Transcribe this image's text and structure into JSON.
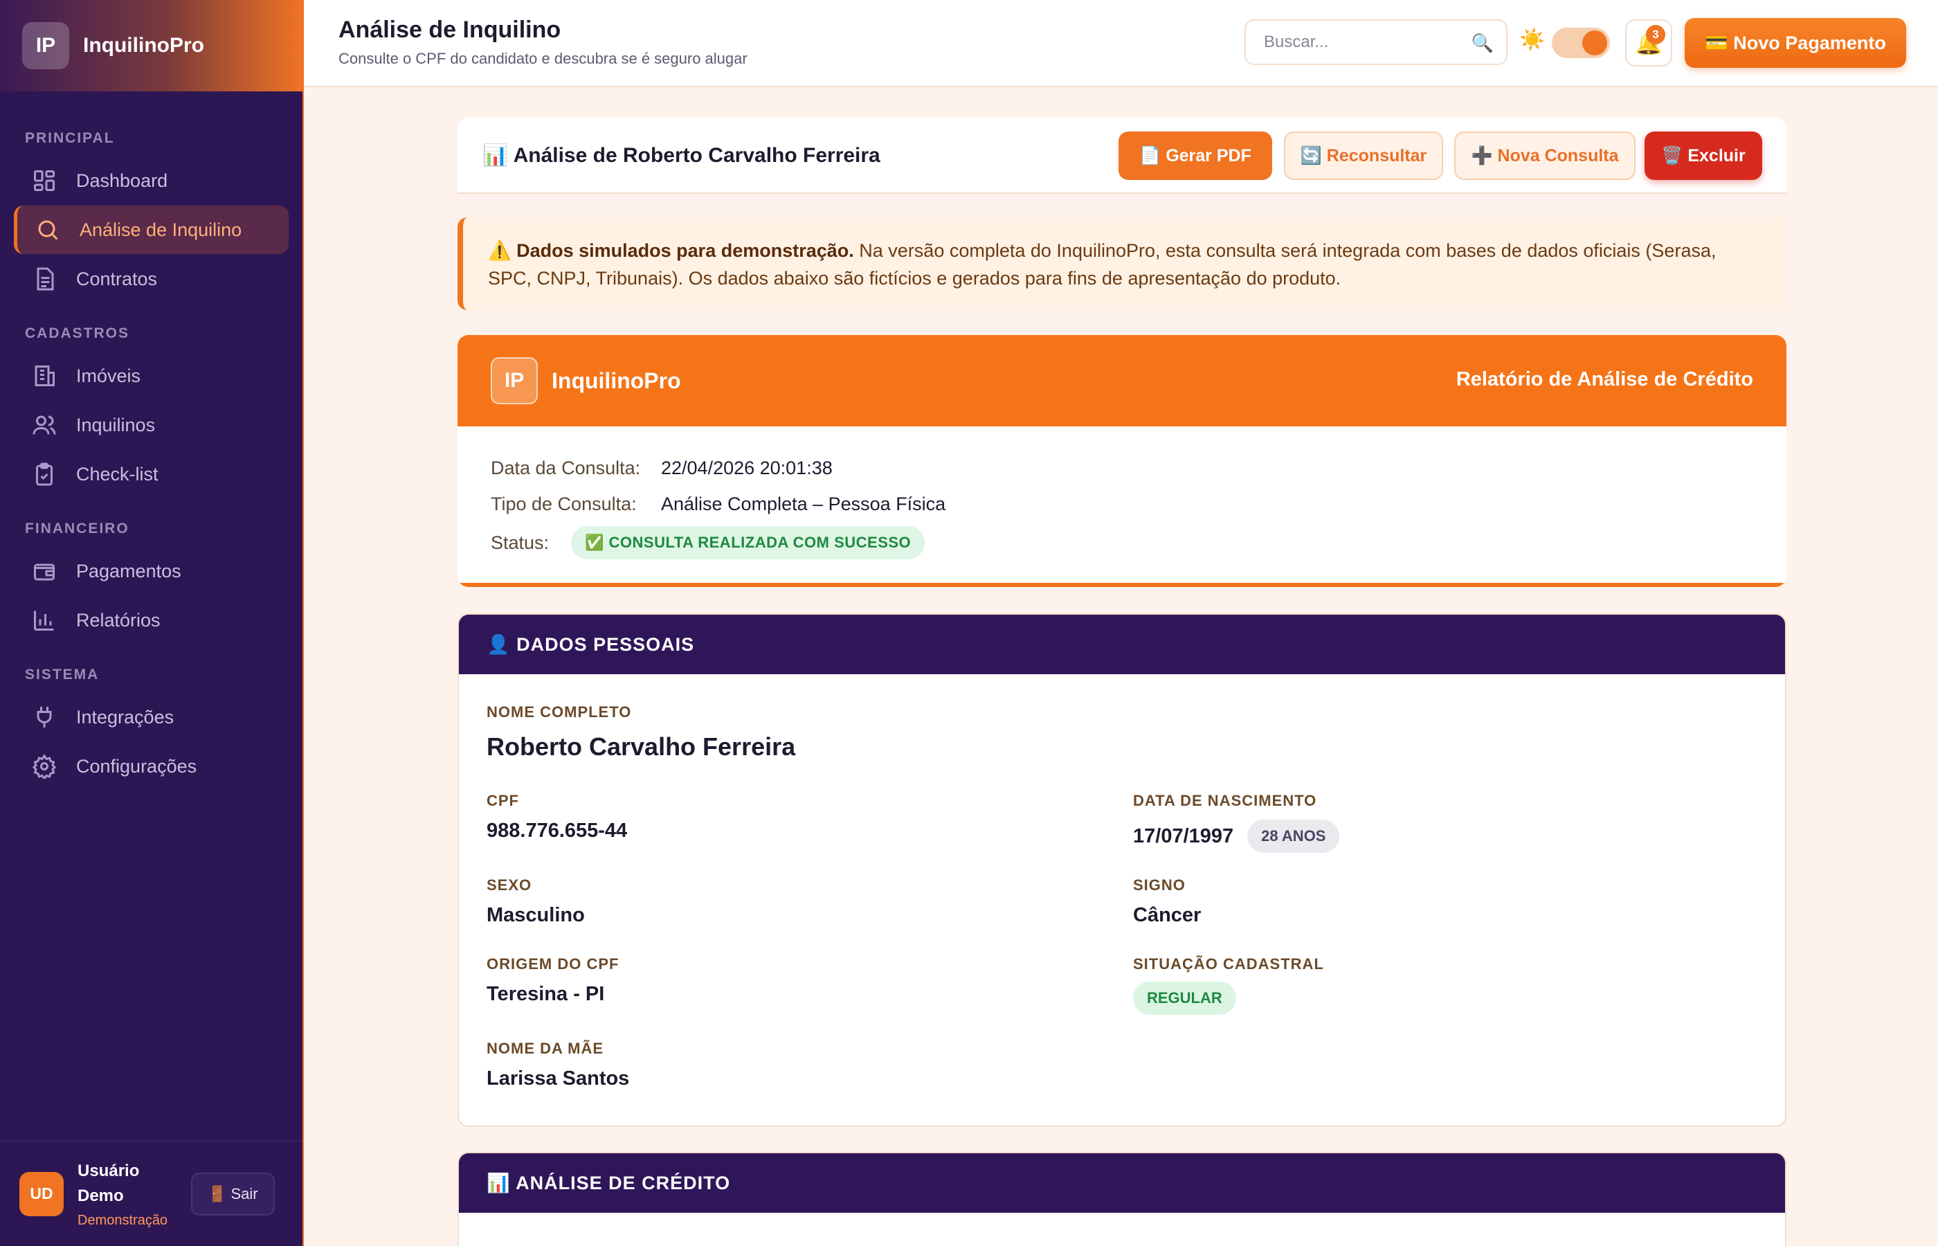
{
  "brand": {
    "initials": "IP",
    "name": "InquilinoPro"
  },
  "nav": {
    "sections": {
      "principal": "PRINCIPAL",
      "cadastros": "CADASTROS",
      "financeiro": "FINANCEIRO",
      "sistema": "SISTEMA"
    },
    "items": [
      {
        "label": "Dashboard",
        "icon": "dashboard-icon"
      },
      {
        "label": "Análise de Inquilino",
        "icon": "search-icon",
        "active": true
      },
      {
        "label": "Contratos",
        "icon": "document-icon"
      },
      {
        "label": "Imóveis",
        "icon": "building-icon"
      },
      {
        "label": "Inquilinos",
        "icon": "users-icon"
      },
      {
        "label": "Check-list",
        "icon": "clipboard-check-icon"
      },
      {
        "label": "Pagamentos",
        "icon": "wallet-icon"
      },
      {
        "label": "Relatórios",
        "icon": "bar-chart-icon"
      },
      {
        "label": "Integrações",
        "icon": "plug-icon"
      },
      {
        "label": "Configurações",
        "icon": "gear-icon"
      }
    ]
  },
  "user": {
    "initials": "UD",
    "name": "Usuário Demo",
    "role": "Demonstração",
    "logout": "🚪 Sair"
  },
  "header": {
    "title": "Análise de Inquilino",
    "subtitle": "Consulte o CPF do candidato e descubra se é seguro alugar",
    "search_placeholder": "Buscar...",
    "notifications": "3",
    "new_payment": "💳 Novo Pagamento"
  },
  "analysis": {
    "title": "📊 Análise de Roberto Carvalho Ferreira",
    "buttons": {
      "pdf": "📄 Gerar PDF",
      "reconsult": "🔄 Reconsultar",
      "new": "➕ Nova Consulta",
      "delete": "🗑️ Excluir"
    }
  },
  "warning": {
    "bold": "⚠️ Dados simulados para demonstração.",
    "text": " Na versão completa do InquilinoPro, esta consulta será integrada com bases de dados oficiais (Serasa, SPC, CNPJ, Tribunais). Os dados abaixo são fictícios e gerados para fins de apresentação do produto."
  },
  "report": {
    "logo": "IP",
    "brand": "InquilinoPro",
    "subtitle": "Relatório de Análise de Crédito",
    "date_label": "Data da Consulta:",
    "date_value": "22/04/2026 20:01:38",
    "type_label": "Tipo de Consulta:",
    "type_value": "Análise Completa – Pessoa Física",
    "status_label": "Status:",
    "status_value": "✅ CONSULTA REALIZADA COM SUCESSO"
  },
  "personal": {
    "heading": "👤 DADOS PESSOAIS",
    "name_label": "NOME COMPLETO",
    "name": "Roberto Carvalho Ferreira",
    "cpf_label": "CPF",
    "cpf": "988.776.655-44",
    "birth_label": "DATA DE NASCIMENTO",
    "birth": "17/07/1997",
    "age": "28 ANOS",
    "sex_label": "SEXO",
    "sex": "Masculino",
    "sign_label": "SIGNO",
    "sign": "Câncer",
    "origin_label": "ORIGEM DO CPF",
    "origin": "Teresina - PI",
    "status_label": "SITUAÇÃO CADASTRAL",
    "status": "REGULAR",
    "mother_label": "NOME DA MÃE",
    "mother": "Larissa Santos"
  },
  "credit": {
    "heading": "📊 ANÁLISE DE CRÉDITO"
  }
}
